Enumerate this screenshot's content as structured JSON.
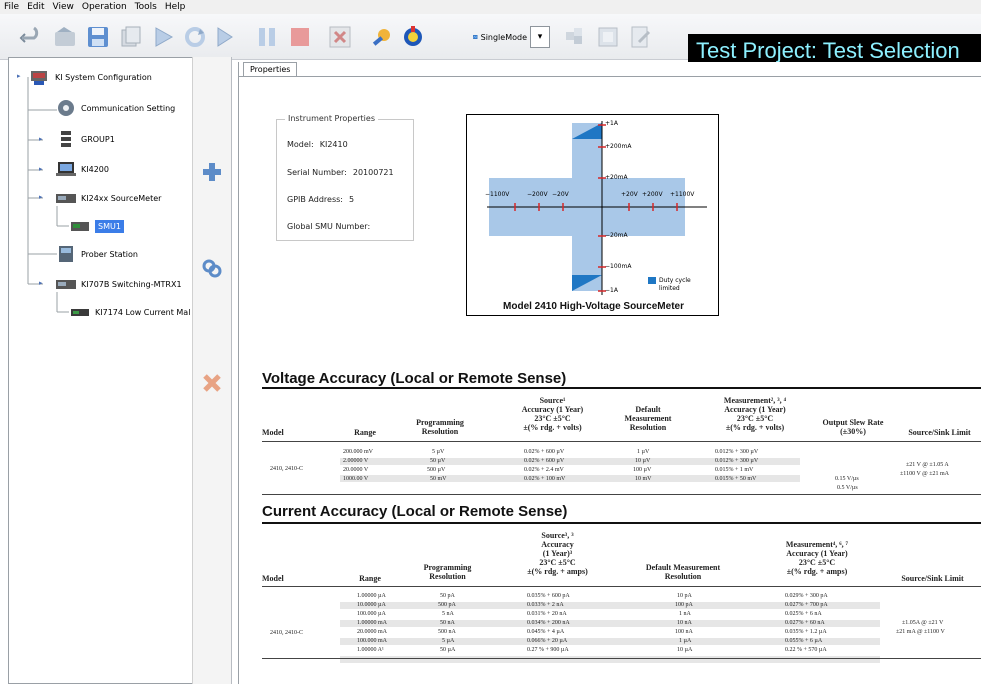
{
  "menu": [
    "File",
    "Edit",
    "View",
    "Operation",
    "Tools",
    "Help"
  ],
  "toolbar": {
    "mode_label": "SingleMode",
    "project_title": "Test Project: Test Selection"
  },
  "tree": {
    "items": [
      {
        "label": "KI System Configuration",
        "icon": "system-config-icon"
      },
      {
        "label": "Communication Setting",
        "icon": "gear-icon"
      },
      {
        "label": "GROUP1",
        "icon": "server-icon"
      },
      {
        "label": "KI4200",
        "icon": "laptop-icon"
      },
      {
        "label": "KI24xx SourceMeter",
        "icon": "instrument-icon"
      },
      {
        "label": "SMU1",
        "icon": "smu-icon"
      },
      {
        "label": "Prober Station",
        "icon": "prober-icon"
      },
      {
        "label": "KI707B Switching-MTRX1",
        "icon": "instrument-icon"
      },
      {
        "label": "KI7174 Low Current Mal",
        "icon": "matrix-card-icon"
      }
    ]
  },
  "side_buttons": [
    "add-icon",
    "link-icon",
    "delete-icon"
  ],
  "properties": {
    "tab_label": "Properties",
    "group_label": "Instrument Properties",
    "model_label": "Model:",
    "model_value": "KI2410",
    "serial_label": "Serial Number:",
    "serial_value": "20100721",
    "gpib_label": "GPIB Address:",
    "gpib_value": "5",
    "global_smu_label": "Global SMU Number:",
    "global_smu_value": ""
  },
  "quadrant": {
    "caption": "Model 2410 High-Voltage SourceMeter",
    "y_labels": [
      "+1A",
      "+200mA",
      "+20mA",
      "−20mA",
      "−100mA",
      "−1A"
    ],
    "x_labels": [
      "−1100V",
      "−200V",
      "−20V",
      "+20V",
      "+200V",
      "+1100V"
    ],
    "legend_line1": "Duty cycle",
    "legend_line2": "limited",
    "region_color": "#a9c8e8",
    "duty_color": "#1f77c4"
  },
  "voltage": {
    "title": "Voltage Accuracy (Local or Remote Sense)",
    "headers": {
      "model": "Model",
      "range": "Range",
      "prog1": "Programming",
      "prog2": "Resolution",
      "src1": "Source¹",
      "src2": "Accuracy (1 Year)",
      "src3": "23°C ±5°C",
      "src4": "±(% rdg. + volts)",
      "def1": "Default",
      "def2": "Measurement",
      "def3": "Resolution",
      "meas1": "Measurement², ³, ⁴",
      "meas2": "Accuracy (1 Year)",
      "meas3": "23°C ±5°C",
      "meas4": "±(% rdg. + volts)",
      "slew1": "Output Slew Rate",
      "slew2": "(±30%)",
      "limit": "Source/Sink Limit"
    },
    "model": "2410, 2410-C",
    "rows": [
      {
        "range": "200.000 mV",
        "prog": "5 µV",
        "src": "0.02% + 600 µV",
        "def": "1 µV",
        "meas": "0.012% + 300 µV",
        "slew": ""
      },
      {
        "range": "2.00000  V",
        "prog": "50 µV",
        "src": "0.02% + 600 µV",
        "def": "10 µV",
        "meas": "0.012% + 300 µV",
        "slew": ""
      },
      {
        "range": "20.0000  V",
        "prog": "500 µV",
        "src": "0.02% + 2.4 mV",
        "def": "100 µV",
        "meas": "0.015% +   1 mV",
        "slew": "0.15 V/µs"
      },
      {
        "range": "1000.00  V",
        "prog": "50 mV",
        "src": "0.02% + 100 mV",
        "def": "10 mV",
        "meas": "0.015% +   50 mV",
        "slew": "0.5 V/µs"
      }
    ],
    "limit1": "±21 V @ ±1.05 A",
    "limit2": "±1100 V @ ±21 mA"
  },
  "current": {
    "title": "Current Accuracy (Local or Remote Sense)",
    "headers": {
      "model": "Model",
      "range": "Range",
      "prog1": "Programming",
      "prog2": "Resolution",
      "src1": "Source³, ³",
      "src2": "Accuracy",
      "src3": "(1 Year)³",
      "src4": "23°C ±5°C",
      "src5": "±(% rdg. + amps)",
      "def1": "Default Measurement",
      "def2": "Resolution",
      "meas1": "Measurement⁴, ⁶, ⁷",
      "meas2": "Accuracy (1 Year)",
      "meas3": "23°C ±5°C",
      "meas4": "±(% rdg. + amps)",
      "limit": "Source/Sink Limit"
    },
    "model": "2410, 2410-C",
    "rows": [
      {
        "range": "1.00000 µA",
        "prog": "50 pA",
        "src": "0.035% + 600 pA",
        "def": "10 pA",
        "meas": "0.029% + 300 pA"
      },
      {
        "range": "10.0000 µA",
        "prog": "500 pA",
        "src": "0.033% +   2 nA",
        "def": "100 pA",
        "meas": "0.027% + 700 pA"
      },
      {
        "range": "100.000 µA",
        "prog": "5 nA",
        "src": "0.031% +  20 nA",
        "def": "1 nA",
        "meas": "0.025% +   6 nA"
      },
      {
        "range": "1.00000 mA",
        "prog": "50 nA",
        "src": "0.034% + 200 nA",
        "def": "10 nA",
        "meas": "0.027% +  60 nA"
      },
      {
        "range": "20.0000 mA",
        "prog": "500 nA",
        "src": "0.045% +   4 µA",
        "def": "100 nA",
        "meas": "0.035% + 1.2 µA"
      },
      {
        "range": "100.000 mA",
        "prog": "5 µA",
        "src": "0.066% +  20 µA",
        "def": "1 µA",
        "meas": "0.055% +   6 µA"
      },
      {
        "range": "1.00000 A¹",
        "prog": "50 µA",
        "src": "0.27  % + 900 µA",
        "def": "10 µA",
        "meas": "0.22  % + 570 µA"
      }
    ],
    "limit1": "±1.05A @ ±21 V",
    "limit2": "±21 mA @ ±1100 V"
  }
}
